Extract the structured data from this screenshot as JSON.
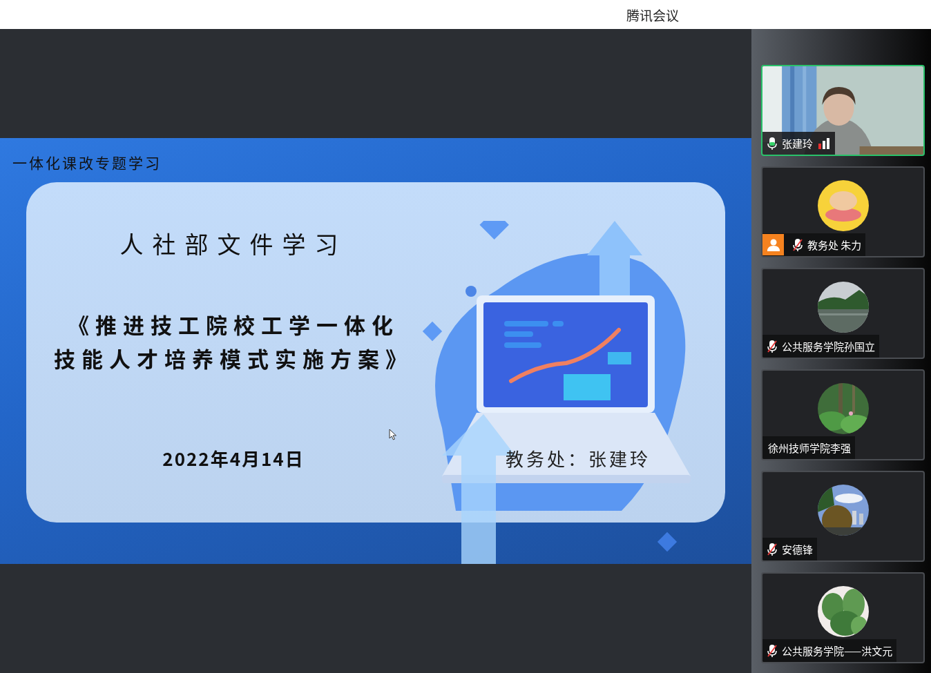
{
  "window": {
    "title": "腾讯会议"
  },
  "slide": {
    "header": "一体化课改专题学习",
    "title": "人社部文件学习",
    "subtitle_lines": [
      "《推进技工院校工学一体化",
      "技能人才培养模式实施方案》"
    ],
    "date": "2022年4月14日",
    "presenter": "教务处：张建玲"
  },
  "participants": [
    {
      "kind": "video",
      "name": "张建玲",
      "mic_shown": true,
      "muted": false,
      "speaking": true,
      "badge": false
    },
    {
      "kind": "avatar",
      "name": "教务处 朱力",
      "mic_shown": true,
      "muted": true,
      "speaking": false,
      "badge": true
    },
    {
      "kind": "avatar",
      "name": "公共服务学院孙国立",
      "mic_shown": true,
      "muted": true,
      "speaking": false,
      "badge": false
    },
    {
      "kind": "avatar",
      "name": "徐州技师学院李强",
      "mic_shown": false,
      "speaking": false,
      "badge": false
    },
    {
      "kind": "avatar",
      "name": "安德锋",
      "mic_shown": true,
      "muted": true,
      "speaking": false,
      "badge": false
    },
    {
      "kind": "avatar",
      "name": "公共服务学院——洪文元",
      "mic_shown": true,
      "muted": true,
      "speaking": false,
      "badge": false
    }
  ]
}
